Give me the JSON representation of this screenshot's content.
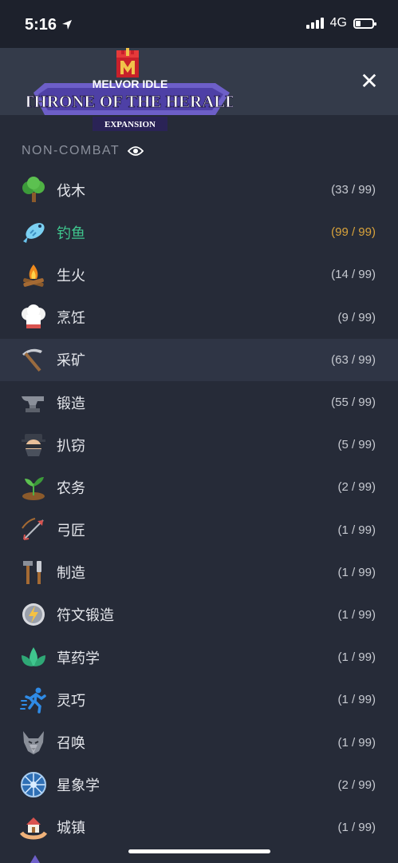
{
  "status": {
    "time": "5:16",
    "network": "4G"
  },
  "header": {
    "logo_game": "MELVOR IDLE",
    "logo_title": "THRONE OF THE HERALD",
    "logo_sub": "EXPANSION",
    "close_label": "✕"
  },
  "section": {
    "title": "NON-COMBAT"
  },
  "skills": [
    {
      "name": "伐木",
      "level": "(33 / 99)",
      "icon": "tree-icon"
    },
    {
      "name": "钓鱼",
      "level": "(99 / 99)",
      "icon": "fish-icon",
      "maxed": true
    },
    {
      "name": "生火",
      "level": "(14 / 99)",
      "icon": "campfire-icon"
    },
    {
      "name": "烹饪",
      "level": "(9 / 99)",
      "icon": "chef-hat-icon"
    },
    {
      "name": "采矿",
      "level": "(63 / 99)",
      "icon": "pickaxe-icon",
      "active": true
    },
    {
      "name": "锻造",
      "level": "(55 / 99)",
      "icon": "anvil-icon"
    },
    {
      "name": "扒窃",
      "level": "(5 / 99)",
      "icon": "thief-icon"
    },
    {
      "name": "农务",
      "level": "(2 / 99)",
      "icon": "sprout-icon"
    },
    {
      "name": "弓匠",
      "level": "(1 / 99)",
      "icon": "bow-arrow-icon"
    },
    {
      "name": "制造",
      "level": "(1 / 99)",
      "icon": "tools-icon"
    },
    {
      "name": "符文锻造",
      "level": "(1 / 99)",
      "icon": "rune-icon"
    },
    {
      "name": "草药学",
      "level": "(1 / 99)",
      "icon": "herb-leaf-icon"
    },
    {
      "name": "灵巧",
      "level": "(1 / 99)",
      "icon": "running-man-icon"
    },
    {
      "name": "召唤",
      "level": "(1 / 99)",
      "icon": "wolf-icon"
    },
    {
      "name": "星象学",
      "level": "(2 / 99)",
      "icon": "astrology-wheel-icon"
    },
    {
      "name": "城镇",
      "level": "(1 / 99)",
      "icon": "house-hands-icon"
    }
  ],
  "colors": {
    "maxed_name": "#3fc68e",
    "maxed_level": "#d9a33b",
    "active_row": "#2f3545"
  }
}
